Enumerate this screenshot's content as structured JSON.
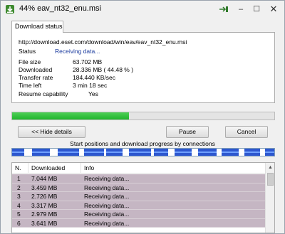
{
  "window": {
    "title": "44% eav_nt32_enu.msi",
    "controls": {
      "minimize": "–",
      "maximize": "☐",
      "close": "✕"
    }
  },
  "tab": {
    "label": "Download status"
  },
  "download": {
    "url": "http://download.eset.com/download/win/eav/eav_nt32_enu.msi",
    "status_label": "Status",
    "status_value": "Receiving data...",
    "fields": [
      {
        "label": "File size",
        "value": "63.702  MB"
      },
      {
        "label": "Downloaded",
        "value": "28.336  MB  ( 44.48 % )"
      },
      {
        "label": "Transfer rate",
        "value": "184.440  KB/sec"
      },
      {
        "label": "Time left",
        "value": "3 min 18 sec"
      }
    ],
    "resume_label": "Resume capability",
    "resume_value": "Yes",
    "progress_fraction": 0.4448
  },
  "buttons": {
    "hide_details": "<< Hide details",
    "pause": "Pause",
    "cancel": "Cancel"
  },
  "connections_caption": "Start positions and download progress by connections",
  "connection_segments": [
    {
      "start": 0.0,
      "length": 0.045
    },
    {
      "start": 0.075,
      "length": 0.07
    },
    {
      "start": 0.175,
      "length": 0.08
    },
    {
      "start": 0.275,
      "length": 0.075
    },
    {
      "start": 0.36,
      "length": 0.06
    },
    {
      "start": 0.445,
      "length": 0.085
    },
    {
      "start": 0.54,
      "length": 0.055
    },
    {
      "start": 0.62,
      "length": 0.065
    },
    {
      "start": 0.71,
      "length": 0.07
    },
    {
      "start": 0.8,
      "length": 0.065
    },
    {
      "start": 0.885,
      "length": 0.06
    },
    {
      "start": 0.965,
      "length": 0.035
    }
  ],
  "table": {
    "columns": [
      "N.",
      "Downloaded",
      "Info"
    ],
    "rows": [
      {
        "n": "1",
        "downloaded": "7.044  MB",
        "info": "Receiving data..."
      },
      {
        "n": "2",
        "downloaded": "3.459  MB",
        "info": "Receiving data..."
      },
      {
        "n": "3",
        "downloaded": "2.726  MB",
        "info": "Receiving data..."
      },
      {
        "n": "4",
        "downloaded": "3.317  MB",
        "info": "Receiving data..."
      },
      {
        "n": "5",
        "downloaded": "2.979  MB",
        "info": "Receiving data..."
      },
      {
        "n": "6",
        "downloaded": "3.641  MB",
        "info": "Receiving data..."
      }
    ]
  }
}
